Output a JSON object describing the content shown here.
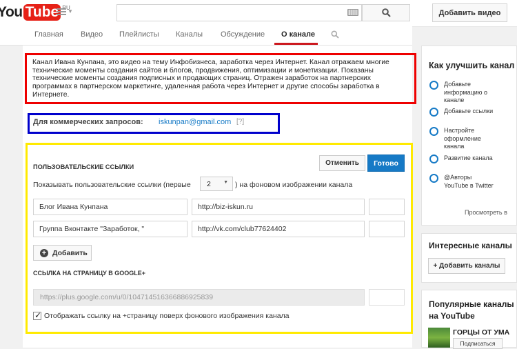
{
  "header": {
    "logo_you": "You",
    "logo_tube": "Tube",
    "logo_region": "RU",
    "search_placeholder": "",
    "upload_label": "Добавить видео"
  },
  "tabs": [
    {
      "label": "Главная"
    },
    {
      "label": "Видео"
    },
    {
      "label": "Плейлисты"
    },
    {
      "label": "Каналы"
    },
    {
      "label": "Обсуждение"
    },
    {
      "label": "О канале",
      "active": true
    }
  ],
  "about": {
    "description": "Канал Ивана Кунпана, это видео на тему Инфобизнеса, заработка через Интернет. Канал отражаем многие технические моменты создания сайтов и блогов, продвижения, оптимизации и монетизации. Показаны технические моменты создания подписных и продающих страниц. Отражен заработок на партнерских программах в партнерском маркетинге, удаленная работа через Интернет и другие способы заработка в Интернете.",
    "business_label": "Для коммерческих запросов:",
    "business_email": "iskunpan@gmail.com",
    "business_help": "[?]"
  },
  "custom_links": {
    "heading": "ПОЛЬЗОВАТЕЛЬСКИЕ ССЫЛКИ",
    "cancel_label": "Отменить",
    "done_label": "Готово",
    "show_prefix": "Показывать пользовательские ссылки (первые",
    "show_count": "2",
    "show_suffix": ") на фоновом изображении канала",
    "links": [
      {
        "title": "Блог Ивана Кунпана",
        "url": "http://biz-iskun.ru"
      },
      {
        "title": "Группа Вконтакте \"Заработок, \"",
        "url": "http://vk.com/club77624402"
      }
    ],
    "add_label": "Добавить"
  },
  "google_plus": {
    "heading": "ССЫЛКА НА СТРАНИЦУ В GOOGLE+",
    "url": "https://plus.google.com/u/0/104714516366886925839",
    "checkbox_checked": true,
    "checkbox_label": "Отображать ссылку на +страницу поверх фонового изображения канала"
  },
  "sidebar": {
    "improve_title": "Как улучшить канал",
    "steps": [
      "Добавьте информацию о канале",
      "Добавьте ссылки",
      "Настройте оформление канала",
      "Развитие канала",
      "@Авторы YouTube в Twitter"
    ],
    "view_label": "Просмотреть в",
    "interesting_title": "Интересные каналы",
    "add_channels_label": "+ Добавить каналы",
    "popular_title_line1": "Популярные каналы",
    "popular_title_line2": "на YouTube",
    "popular_channel_name": "ГОРЦЫ ОТ УМА",
    "subscribe_label": "Подписаться"
  },
  "colors": {
    "youtube_red": "#e62117",
    "blue_button": "#167ac6",
    "annotation_red": "#ee0000",
    "annotation_blue": "#0000cc",
    "annotation_yellow": "#ffea00"
  }
}
